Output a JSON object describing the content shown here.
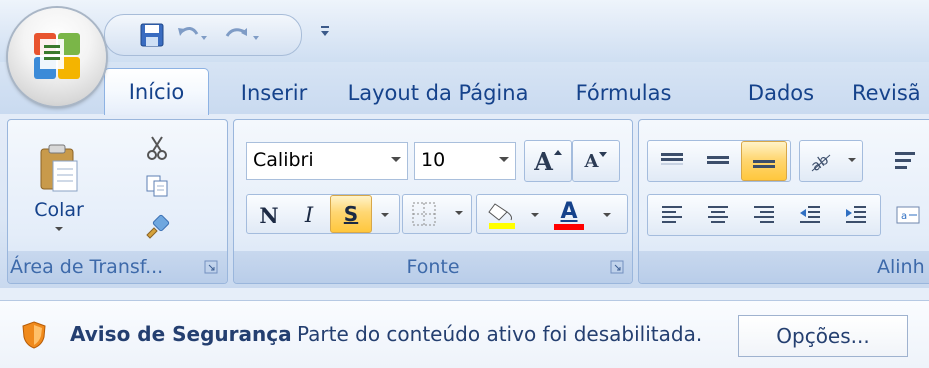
{
  "quick_access": {
    "items": [
      "save-icon",
      "undo-icon",
      "redo-icon",
      "customize-qat-icon"
    ]
  },
  "tabs": [
    {
      "label": "Início",
      "active": true
    },
    {
      "label": "Inserir"
    },
    {
      "label": "Layout da Página"
    },
    {
      "label": "Fórmulas"
    },
    {
      "label": "Dados"
    },
    {
      "label": "Revisã"
    }
  ],
  "clipboard_group": {
    "label": "Área de Transf...",
    "paste_label": "Colar"
  },
  "font_group": {
    "label": "Fonte",
    "font_name": "Calibri",
    "font_size": "10",
    "bold_glyph": "N",
    "italic_glyph": "I",
    "underline_glyph": "S",
    "grow_glyph": "A",
    "shrink_glyph": "A",
    "font_color_glyph": "A",
    "fill_color": "#ffff00",
    "font_color": "#ff0000"
  },
  "alignment_group": {
    "label": "Alinh"
  },
  "security_bar": {
    "title": "Aviso de Segurança",
    "message": "Parte do conteúdo ativo foi desabilitada.",
    "options_label": "Opções..."
  },
  "colors": {
    "tab_text": "#15428b",
    "group_label": "#3e6aaa",
    "highlight": "#ffc73d"
  }
}
